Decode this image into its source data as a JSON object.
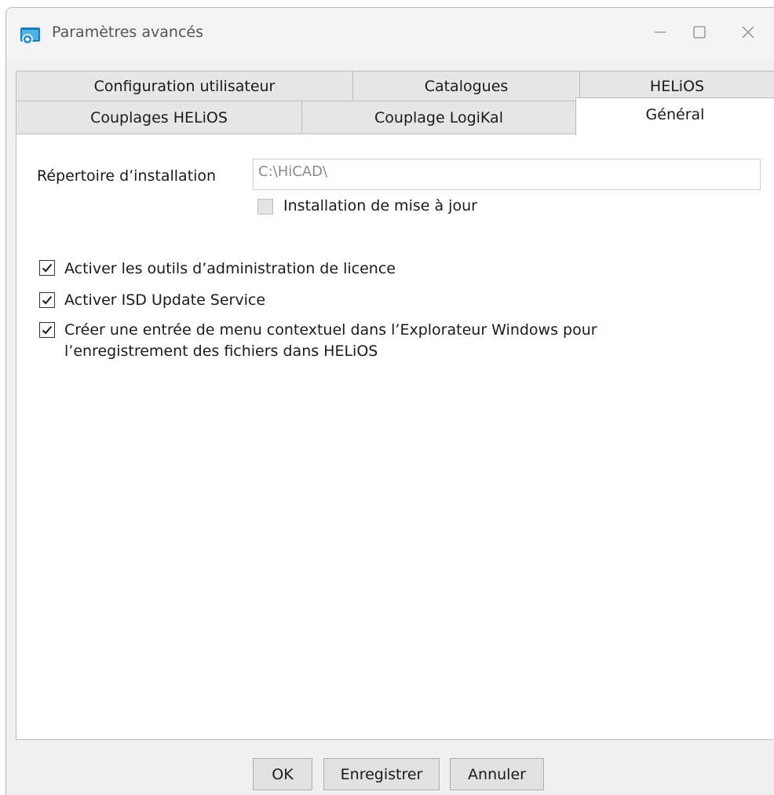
{
  "window": {
    "title": "Paramètres avancés"
  },
  "tabs": {
    "row1": [
      {
        "label": "Configuration utilisateur"
      },
      {
        "label": "Catalogues"
      },
      {
        "label": "HELiOS"
      }
    ],
    "row2": [
      {
        "label": "Couplages HELiOS"
      },
      {
        "label": "Couplage LogiKal"
      },
      {
        "label": "Général"
      }
    ],
    "active": "Général"
  },
  "general": {
    "install_dir_label": "Répertoire d’installation",
    "install_dir_value": "C:\\HiCAD\\",
    "update_install_label": "Installation de mise à jour",
    "update_install_checked": false,
    "options": [
      {
        "label": "Activer les outils d’administration de licence",
        "checked": true
      },
      {
        "label": "Activer ISD Update Service",
        "checked": true
      },
      {
        "label_line1": "Créer une entrée de menu contextuel dans l’Explorateur Windows pour",
        "label_line2": "l’enregistrement des fichiers dans HELiOS",
        "checked": true
      }
    ]
  },
  "buttons": {
    "ok": "OK",
    "save": "Enregistrer",
    "cancel": "Annuler"
  },
  "icons": {
    "app": "app-window-icon",
    "minimize": "minimize-icon",
    "maximize": "maximize-icon",
    "close": "close-icon",
    "check": "check-icon"
  },
  "colors": {
    "window_bg": "#f0f0f0",
    "panel_bg": "#ffffff",
    "tab_bg": "#e6e6e6",
    "border": "#bdbdbd",
    "button_bg": "#e1e1e1"
  }
}
